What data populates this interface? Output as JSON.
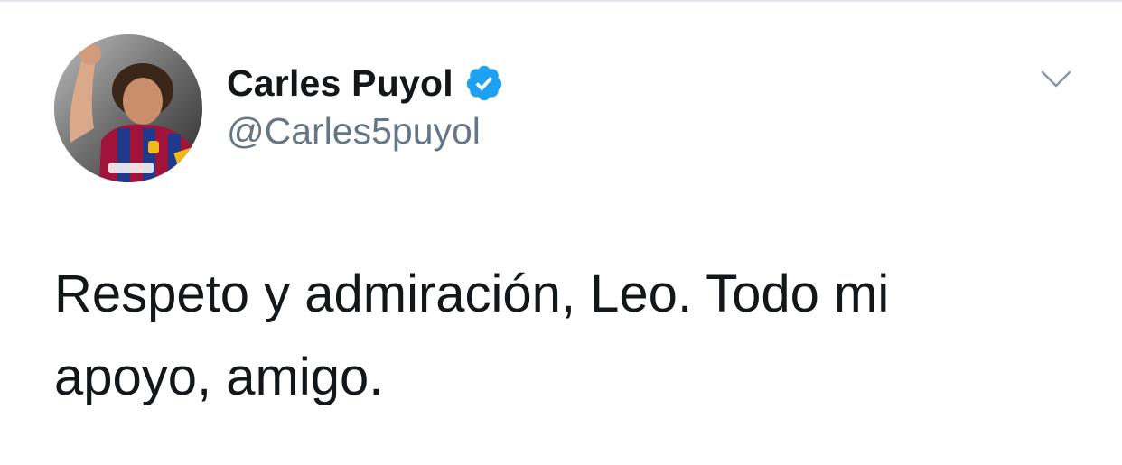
{
  "tweet": {
    "author": {
      "display_name": "Carles Puyol",
      "handle": "@Carles5puyol",
      "verified": true,
      "avatar_icon": "profile-photo"
    },
    "text": "Respeto y admiración, Leo. Todo mi\napoyo, amigo.",
    "menu_icon": "chevron-down-icon"
  },
  "colors": {
    "name": "#14171a",
    "handle": "#657786",
    "verified_badge": "#1da1f2",
    "caret": "#8899a6",
    "divider": "#e1e8ed"
  }
}
